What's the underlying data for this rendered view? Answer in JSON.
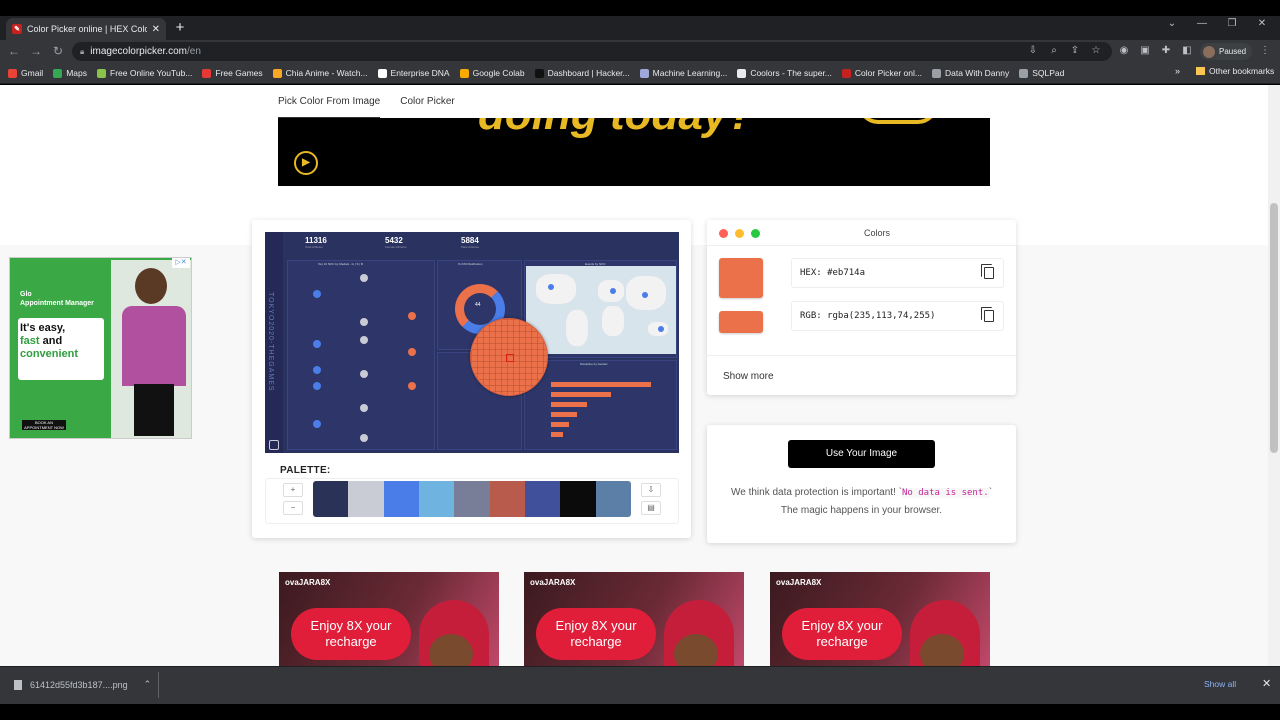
{
  "browser": {
    "tab_title": "Color Picker online | HEX Colo",
    "new_tab": "+",
    "url_host": "imagecolorpicker.com",
    "url_path": "/en",
    "profile_status": "Paused",
    "other_bookmarks": "Other bookmarks",
    "bookmarks": [
      {
        "label": "Gmail",
        "color": "#ea4335"
      },
      {
        "label": "Maps",
        "color": "#34a853"
      },
      {
        "label": "Free Online YouTub...",
        "color": "#8bc34a"
      },
      {
        "label": "Free Games",
        "color": "#e53935"
      },
      {
        "label": "Chia Anime - Watch...",
        "color": "#f9a825"
      },
      {
        "label": "Enterprise DNA",
        "color": "#ffffff"
      },
      {
        "label": "Google Colab",
        "color": "#f9ab00"
      },
      {
        "label": "Dashboard | Hacker...",
        "color": "#111111"
      },
      {
        "label": "Machine Learning...",
        "color": "#9fa8da"
      },
      {
        "label": "Coolors - The super...",
        "color": "#e8eaed"
      },
      {
        "label": "Color Picker onl...",
        "color": "#c5221f"
      },
      {
        "label": "Data With Danny",
        "color": "#9aa0a6"
      },
      {
        "label": "SQLPad",
        "color": "#9aa0a6"
      }
    ],
    "more_bookmarks": "»"
  },
  "nav": {
    "tabs": [
      {
        "label": "Pick Color From Image",
        "active": true
      },
      {
        "label": "Color Picker",
        "active": false
      }
    ]
  },
  "hero_ad": {
    "slogan": "doing today?"
  },
  "left_ad": {
    "title_line1": "Glo",
    "title_line2": "Appointment Manager",
    "headline_a": "It's easy,",
    "headline_b": "fast",
    "headline_c": "and",
    "headline_d": "convenient",
    "cta": "BOOK AN APPOINTMENT NOW"
  },
  "dashboard": {
    "vertical_title": "TOKYO2020-THEGAMES",
    "stats": [
      {
        "value": "11316",
        "label": "Total Athletes"
      },
      {
        "value": "5432",
        "label": "Female Athletes"
      },
      {
        "value": "5884",
        "label": "Male Athletes"
      }
    ],
    "panel_titles": [
      "Top 10 NOC by Medals - G | S | B",
      "% F/M Distribution",
      "Events by NOC",
      "Discipline by Gender"
    ],
    "donut_center": "44"
  },
  "palette": {
    "label": "PALETTE:",
    "add": "+",
    "remove": "−",
    "colors": [
      "#2a3258",
      "#c9ccd4",
      "#4a7de8",
      "#6fb3e0",
      "#787d98",
      "#b85a4c",
      "#40509a",
      "#0b0b0c",
      "#5b7fa6"
    ]
  },
  "colors_panel": {
    "title": "Colors",
    "hex_value": "HEX: #eb714a",
    "rgb_value": "RGB: rgba(235,113,74,255)",
    "selected_color": "#eb714a",
    "show_more": "Show more"
  },
  "upload": {
    "button_label": "Use Your Image",
    "text_before": "We think data protection is important! `",
    "code_text": "No data is sent.",
    "text_after": "` The magic happens in your browser."
  },
  "bottom_ads": [
    {
      "brand": "ovaJARA8X",
      "line1": "Enjoy 8X your",
      "line2": "recharge"
    },
    {
      "brand": "ovaJARA8X",
      "line1": "Enjoy 8X your",
      "line2": "recharge"
    },
    {
      "brand": "ovaJARA8X",
      "line1": "Enjoy 8X your",
      "line2": "recharge"
    }
  ],
  "downloads": {
    "file_name": "61412d55fd3b187....png",
    "show_all": "Show all",
    "close": "✕"
  }
}
